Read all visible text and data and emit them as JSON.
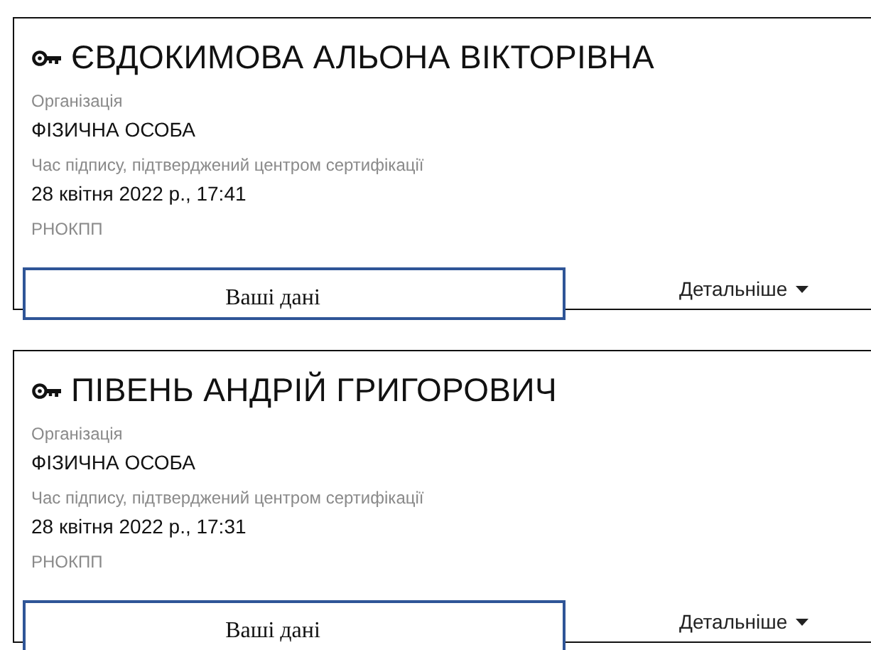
{
  "signatures": [
    {
      "name": "ЄВДОКИМОВА АЛЬОНА ВІКТОРІВНА",
      "fields": [
        {
          "label": "Організація",
          "value": "ФІЗИЧНА ОСОБА"
        },
        {
          "label": "Час підпису, підтверджений центром сертифікації",
          "value": "28 квітня 2022 р., 17:41"
        },
        {
          "label": "РНОКПП"
        }
      ],
      "details_link": "Детальніше",
      "overlay_text": "Ваші дані"
    },
    {
      "name": "ПІВЕНЬ АНДРІЙ ГРИГОРОВИЧ",
      "fields": [
        {
          "label": "Організація",
          "value": "ФІЗИЧНА ОСОБА"
        },
        {
          "label": "Час підпису, підтверджений центром сертифікації",
          "value": "28 квітня 2022 р., 17:31"
        },
        {
          "label": "РНОКПП"
        }
      ],
      "details_link": "Детальніше",
      "overlay_text": "Ваші дані"
    }
  ]
}
